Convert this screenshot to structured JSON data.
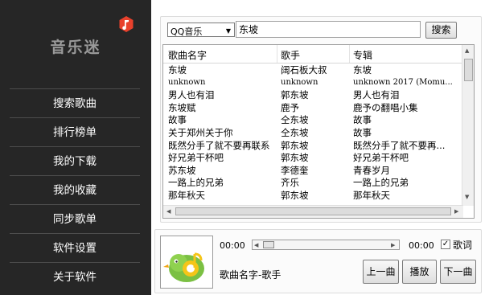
{
  "app": {
    "name": "音乐迷"
  },
  "sidebar": {
    "items": [
      {
        "label": "搜索歌曲"
      },
      {
        "label": "排行榜单"
      },
      {
        "label": "我的下载"
      },
      {
        "label": "我的收藏"
      },
      {
        "label": "同步歌单"
      },
      {
        "label": "软件设置"
      },
      {
        "label": "关于软件"
      }
    ]
  },
  "search": {
    "source_selected": "QQ音乐",
    "query": "东坡",
    "button_label": "搜索"
  },
  "table": {
    "headers": [
      "歌曲名字",
      "歌手",
      "专辑"
    ],
    "rows": [
      {
        "name": "东坡",
        "artist": "阔石板大叔",
        "album": "东坡"
      },
      {
        "name": "unknown",
        "artist": "unknown",
        "album": "unknown 2017 (Momu...",
        "small": true
      },
      {
        "name": "男人也有泪",
        "artist": "郭东坡",
        "album": "男人也有泪"
      },
      {
        "name": "东坡赋",
        "artist": "鹿予",
        "album": "鹿予の翻唱小集"
      },
      {
        "name": "故事",
        "artist": "仝东坡",
        "album": "故事"
      },
      {
        "name": "关于郑州关于你",
        "artist": "仝东坡",
        "album": "故事"
      },
      {
        "name": "既然分手了就不要再联系",
        "artist": "郭东坡",
        "album": "既然分手了就不要再..."
      },
      {
        "name": "好兄弟干杯吧",
        "artist": "郭东坡",
        "album": "好兄弟干杯吧"
      },
      {
        "name": "苏东坡",
        "artist": "李德奎",
        "album": "青春岁月"
      },
      {
        "name": "一路上的兄弟",
        "artist": "齐乐",
        "album": "一路上的兄弟"
      },
      {
        "name": "那年秋天",
        "artist": "郭东坡",
        "album": "那年秋天"
      }
    ]
  },
  "player": {
    "time_current": "00:00",
    "time_total": "00:00",
    "lyrics_label": "歌词",
    "lyrics_checked": true,
    "now_playing": "歌曲名字-歌手",
    "prev_label": "上一曲",
    "play_label": "播放",
    "next_label": "下一曲",
    "progress": 0
  },
  "colors": {
    "sidebar_bg": "#262626",
    "logo_red": "#e8412c",
    "cover_green": "#7bc043"
  }
}
